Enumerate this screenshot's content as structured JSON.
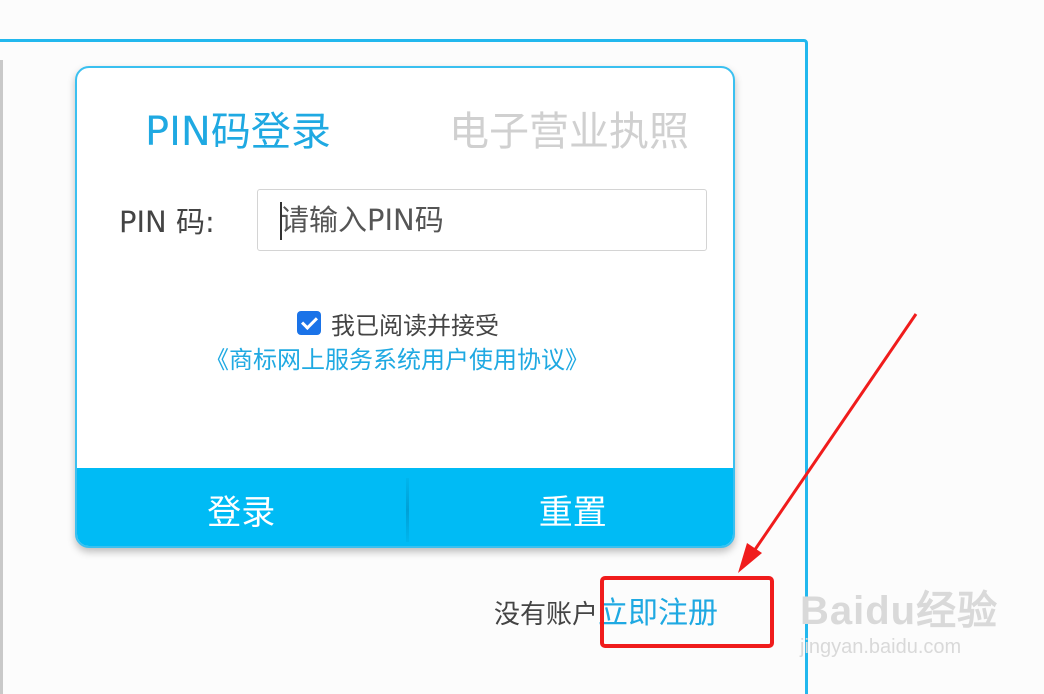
{
  "tabs": {
    "pin_login": "PIN码登录",
    "business_license": "电子营业执照"
  },
  "pin_form": {
    "label": "PIN 码:",
    "placeholder": "请输入PIN码",
    "value": ""
  },
  "agreement": {
    "checked": true,
    "text": "我已阅读并接受",
    "link": "《商标网上服务系统用户使用协议》"
  },
  "buttons": {
    "login": "登录",
    "reset": "重置"
  },
  "register": {
    "prompt": "没有账户",
    "link": "立即注册"
  },
  "watermark": {
    "logo": "Baidu经验",
    "url": "jingyan.baidu.com"
  },
  "colors": {
    "accent": "#1fa9e2",
    "button_bar": "#00bbf5",
    "annotation": "#f01c1c"
  }
}
